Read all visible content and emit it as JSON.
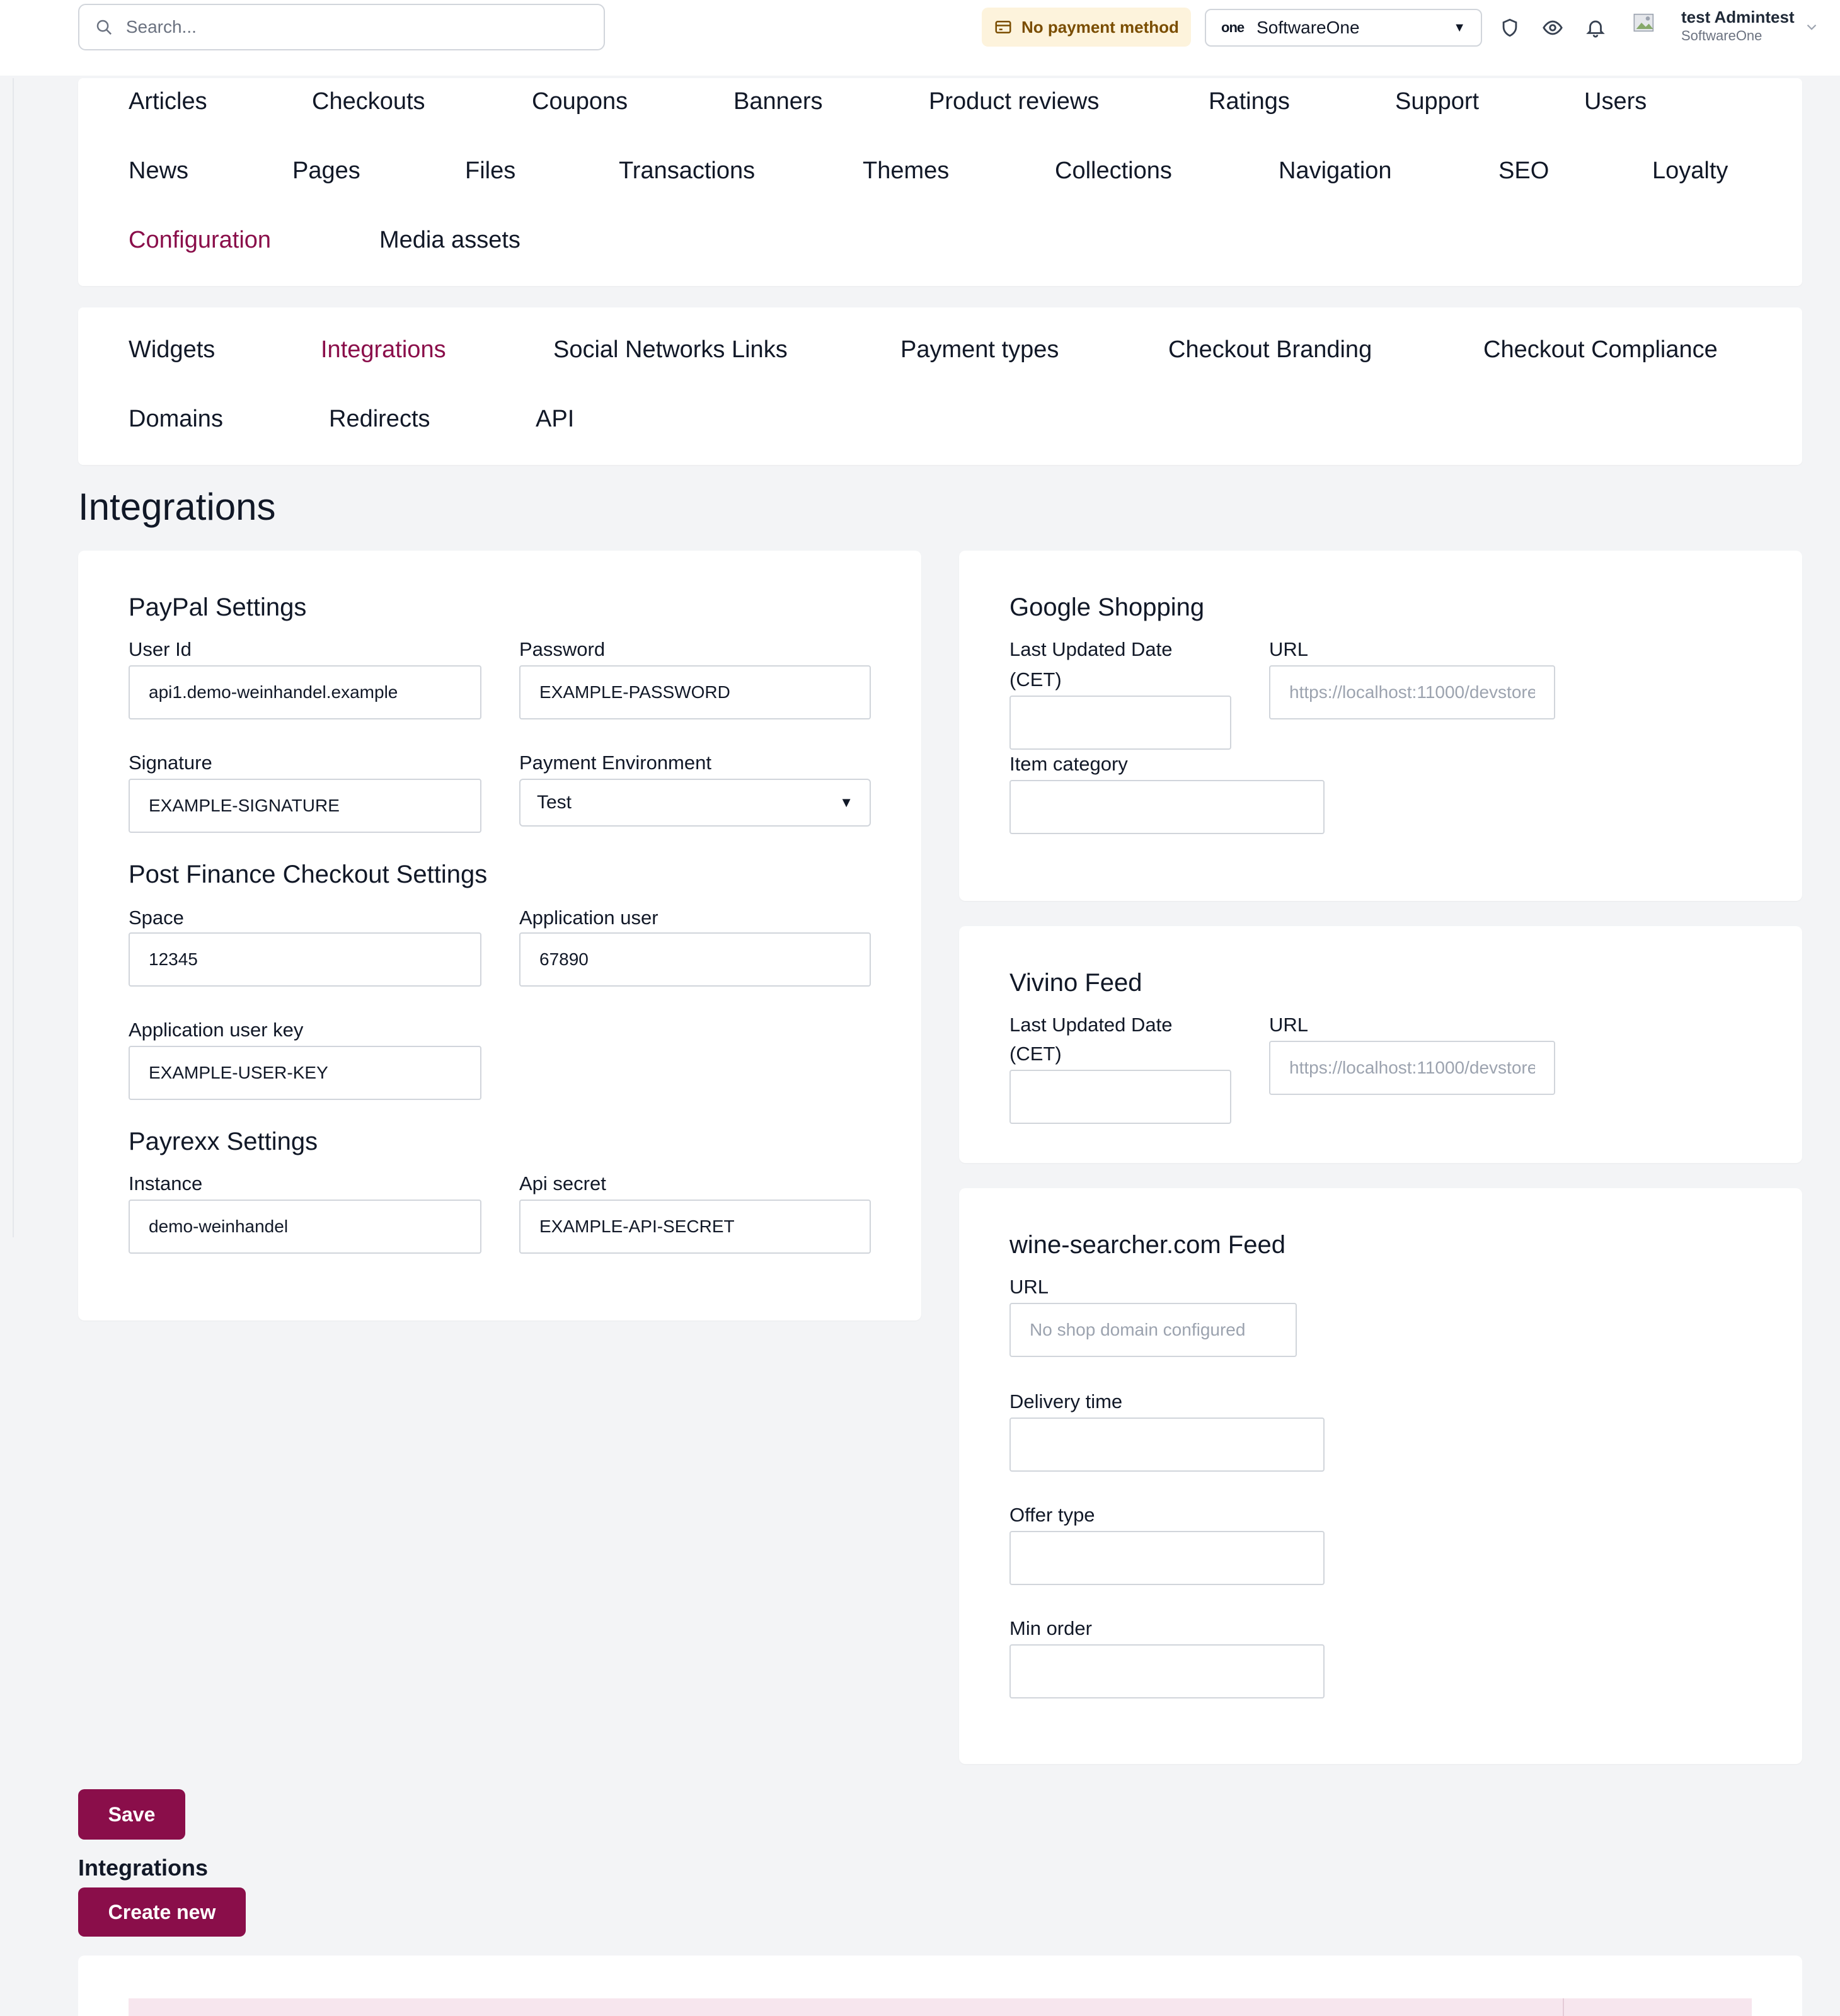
{
  "header": {
    "search_placeholder": "Search...",
    "payment_badge": "No payment method",
    "store": {
      "brand": "one",
      "name": "SoftwareOne"
    },
    "user": {
      "name": "test Admintest",
      "org": "SoftwareOne"
    },
    "icons": [
      "shield-icon",
      "eye-icon",
      "bell-icon"
    ]
  },
  "main_nav": {
    "items": [
      "Articles",
      "Checkouts",
      "Coupons",
      "Banners",
      "Product reviews",
      "Ratings",
      "Support",
      "Users",
      "News",
      "Pages",
      "Files",
      "Transactions",
      "Themes",
      "Collections",
      "Navigation",
      "SEO",
      "Loyalty",
      "Configuration",
      "Media assets"
    ],
    "active": "Configuration"
  },
  "sub_nav": {
    "items": [
      "Widgets",
      "Integrations",
      "Social Networks Links",
      "Payment types",
      "Checkout Branding",
      "Checkout Compliance",
      "Domains",
      "Redirects",
      "API"
    ],
    "active": "Integrations"
  },
  "page_title": "Integrations",
  "paypal": {
    "title": "PayPal Settings",
    "user_id_label": "User Id",
    "user_id": "api1.demo-weinhandel.example",
    "password_label": "Password",
    "password": "EXAMPLE-PASSWORD",
    "signature_label": "Signature",
    "signature": "EXAMPLE-SIGNATURE",
    "env_label": "Payment Environment",
    "env": "Test"
  },
  "postfinance": {
    "title": "Post Finance Checkout Settings",
    "space_label": "Space",
    "space": "12345",
    "app_user_label": "Application user",
    "app_user": "67890",
    "app_key_label": "Application user key",
    "app_key": "EXAMPLE-USER-KEY"
  },
  "payrexx": {
    "title": "Payrexx Settings",
    "instance_label": "Instance",
    "instance": "demo-weinhandel",
    "secret_label": "Api secret",
    "secret": "EXAMPLE-API-SECRET"
  },
  "google": {
    "title": "Google Shopping",
    "date_label_1": "Last Updated Date",
    "date_label_2": "(CET)",
    "url_label": "URL",
    "url": "https://localhost:11000/devstore",
    "category_label": "Item category"
  },
  "vivino": {
    "title": "Vivino Feed",
    "date_label_1": "Last Updated Date",
    "date_label_2": "(CET)",
    "url_label": "URL",
    "url": "https://localhost:11000/devstore"
  },
  "winesearcher": {
    "title": "wine-searcher.com Feed",
    "url_label": "URL",
    "url_placeholder": "No shop domain configured",
    "delivery_label": "Delivery time",
    "offer_label": "Offer type",
    "min_order_label": "Min order"
  },
  "actions": {
    "save": "Save",
    "create_new": "Create new"
  },
  "list_heading": "Integrations",
  "colors": {
    "accent": "#8a0e4a",
    "badge_bg": "#fdf3dc",
    "page_bg": "#f3f4f6"
  }
}
